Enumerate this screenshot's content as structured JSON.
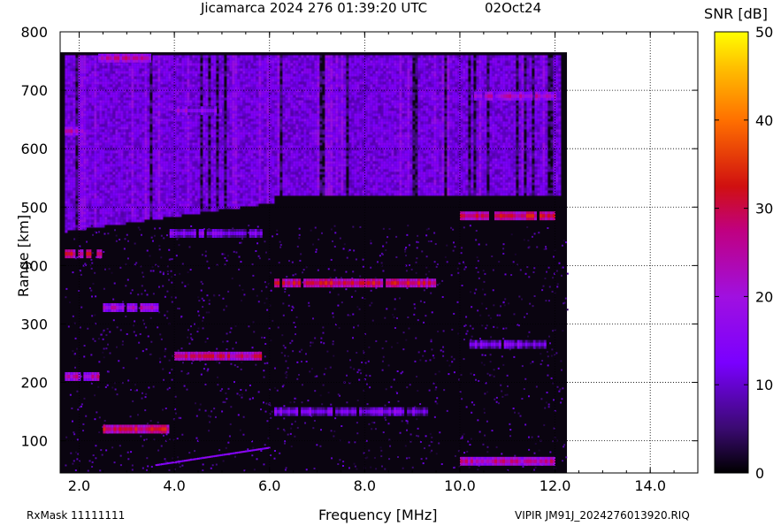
{
  "header": {
    "title": "Jicamarca 2024 276 01:39:20 UTC",
    "date": "02Oct24"
  },
  "footer": {
    "rxmask": "RxMask 11111111",
    "file": "VIPIR  JM91J_2024276013920.RIQ"
  },
  "colors": {
    "background": "#000000",
    "low": "#1a0a2e",
    "mid": "#7a00ff",
    "high": "#ff6a00",
    "max": "#ffff00"
  },
  "chart_data": {
    "type": "heatmap",
    "title": "Jicamarca 2024 276 01:39:20 UTC",
    "xlabel": "Frequency [MHz]",
    "ylabel": "Range [km]",
    "colorbar_label": "SNR [dB]",
    "xlim": [
      1.6,
      15.0
    ],
    "ylim": [
      45,
      800
    ],
    "xticks": [
      2.0,
      4.0,
      6.0,
      8.0,
      10.0,
      12.0,
      14.0
    ],
    "xtick_labels": [
      "2.0",
      "4.0",
      "6.0",
      "8.0",
      "10.0",
      "12.0",
      "14.0"
    ],
    "yticks": [
      100,
      200,
      300,
      400,
      500,
      600,
      700,
      800
    ],
    "ytick_labels": [
      "100",
      "200",
      "300",
      "400",
      "500",
      "600",
      "700",
      "800"
    ],
    "clim": [
      0,
      50
    ],
    "cticks": [
      0,
      10,
      20,
      30,
      40,
      50
    ],
    "ctick_labels": [
      "0",
      "10",
      "20",
      "30",
      "40",
      "50"
    ],
    "grid": true,
    "data_extent": {
      "freq_max": 12.25,
      "range_max": 765
    },
    "echo_traces": [
      {
        "f0": 1.7,
        "f1": 2.5,
        "r": 420,
        "snr": 30
      },
      {
        "f0": 2.5,
        "f1": 3.9,
        "r": 120,
        "snr": 30
      },
      {
        "f0": 4.0,
        "f1": 5.8,
        "r": 245,
        "snr": 28
      },
      {
        "f0": 6.1,
        "f1": 9.5,
        "r": 370,
        "snr": 30
      },
      {
        "f0": 10.0,
        "f1": 12.0,
        "r": 485,
        "snr": 30
      },
      {
        "f0": 10.0,
        "f1": 12.0,
        "r": 65,
        "snr": 25
      },
      {
        "f0": 2.5,
        "f1": 3.7,
        "r": 328,
        "snr": 22
      },
      {
        "f0": 1.7,
        "f1": 2.4,
        "r": 210,
        "snr": 24
      },
      {
        "f0": 1.7,
        "f1": 2.1,
        "r": 630,
        "snr": 22
      },
      {
        "f0": 2.4,
        "f1": 3.5,
        "r": 755,
        "snr": 24
      },
      {
        "f0": 4.0,
        "f1": 5.0,
        "r": 665,
        "snr": 18
      },
      {
        "f0": 10.3,
        "f1": 12.0,
        "r": 690,
        "snr": 22
      },
      {
        "f0": 3.9,
        "f1": 5.8,
        "r": 455,
        "snr": 15
      },
      {
        "f0": 6.1,
        "f1": 9.3,
        "r": 150,
        "snr": 14
      },
      {
        "f0": 10.2,
        "f1": 11.8,
        "r": 265,
        "snr": 14
      }
    ],
    "spread_f_region": {
      "f0": 1.7,
      "f1": 12.1,
      "r_top": 760,
      "r_bottom_low": 460,
      "r_bottom_high": 520,
      "snr": 12
    }
  }
}
